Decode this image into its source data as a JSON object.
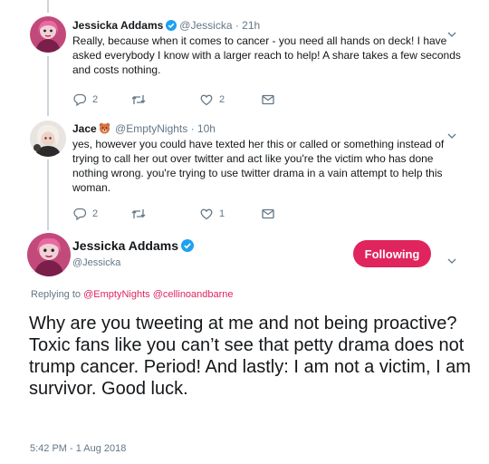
{
  "tweet1": {
    "name": "Jessicka Addams",
    "handle": "@Jessicka",
    "time": "21h",
    "text": "Really, because when it comes to cancer - you need all hands on deck! I have asked everybody I know with a larger reach to help! A share takes a few seconds and costs nothing.",
    "reply_count": "2",
    "retweet_count": "",
    "like_count": "2"
  },
  "tweet2": {
    "name": "Jace",
    "handle": "@EmptyNights",
    "time": "10h",
    "text": "yes, however you could have texted her this or called or something instead of trying to call her out over twitter and act like you're the victim who has done nothing wrong. you're trying to use twitter drama in a vain attempt to help this woman.",
    "reply_count": "2",
    "retweet_count": "",
    "like_count": "1"
  },
  "main_tweet": {
    "name": "Jessicka Addams",
    "handle": "@Jessicka",
    "follow_label": "Following",
    "replying_prefix": "Replying to",
    "replying_to_1": "@EmptyNights",
    "replying_to_2": "@cellinoandbarne",
    "text": "Why are you tweeting at me and not being proactive? Toxic fans like you can’t see that petty drama does not trump cancer. Period! And lastly: I am not a victim, I am survivor. Good luck.",
    "timestamp": "5:42 PM - 1 Aug 2018"
  },
  "colors": {
    "accent": "#e0245e",
    "verified": "#1da1f2",
    "muted": "#657786",
    "line": "#ccd6dd"
  },
  "icons": [
    "reply-icon",
    "retweet-icon",
    "like-icon",
    "message-icon",
    "verified-icon",
    "bear-emoji-icon",
    "chevron-down-icon"
  ]
}
